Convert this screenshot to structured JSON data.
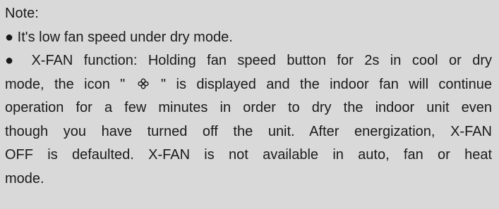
{
  "note": {
    "heading": "Note:",
    "bullet_char": "●",
    "item1": "It's low fan speed under dry mode.",
    "item2_lines": {
      "l1": "X-FAN function: Holding fan speed button for 2s in cool or dry",
      "l2_before_icon": "mode, the icon \"",
      "l2_after_icon": "\" is displayed and the indoor fan will continue",
      "l3": "operation for a few minutes in order to dry the indoor unit even",
      "l4": "though you have turned off the unit. After energization, X-FAN",
      "l5": "OFF is defaulted. X-FAN is not available in auto, fan or heat",
      "l6": "mode."
    },
    "icon": "x-fan-icon"
  }
}
